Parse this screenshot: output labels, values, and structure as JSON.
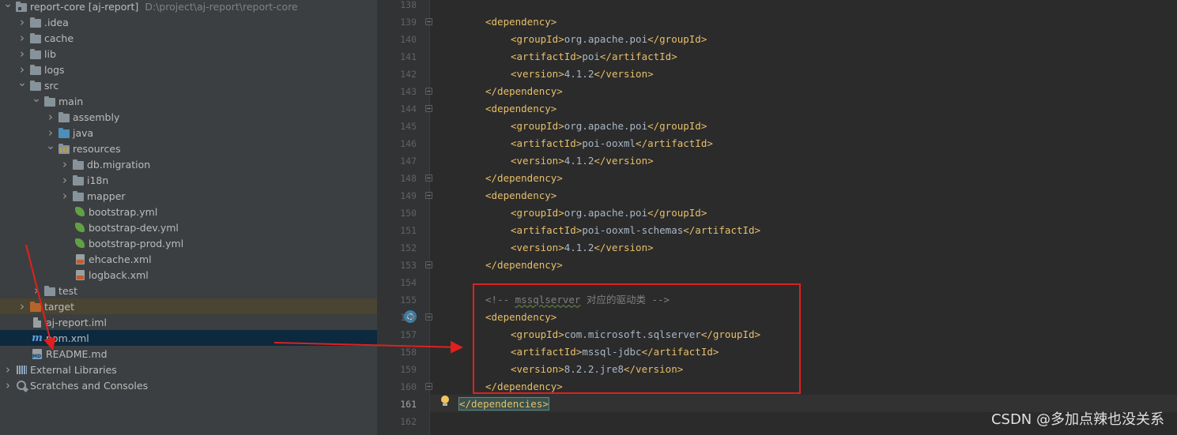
{
  "project_tree": {
    "root": {
      "name": "report-core [aj-report]",
      "path": "D:\\project\\aj-report\\report-core"
    },
    "items": [
      {
        "label": ".idea",
        "icon": "folder-icon"
      },
      {
        "label": "cache",
        "icon": "folder-icon"
      },
      {
        "label": "lib",
        "icon": "folder-icon"
      },
      {
        "label": "logs",
        "icon": "folder-icon"
      },
      {
        "label": "src",
        "icon": "folder-icon"
      },
      {
        "label": "main",
        "icon": "folder-icon"
      },
      {
        "label": "assembly",
        "icon": "folder-icon"
      },
      {
        "label": "java",
        "icon": "source-folder-icon"
      },
      {
        "label": "resources",
        "icon": "resources-folder-icon"
      },
      {
        "label": "db.migration",
        "icon": "folder-icon"
      },
      {
        "label": "i18n",
        "icon": "folder-icon"
      },
      {
        "label": "mapper",
        "icon": "folder-icon"
      },
      {
        "label": "bootstrap.yml",
        "icon": "spring-leaf-icon"
      },
      {
        "label": "bootstrap-dev.yml",
        "icon": "spring-leaf-icon"
      },
      {
        "label": "bootstrap-prod.yml",
        "icon": "spring-leaf-icon"
      },
      {
        "label": "ehcache.xml",
        "icon": "xml-file-icon"
      },
      {
        "label": "logback.xml",
        "icon": "xml-file-icon"
      },
      {
        "label": "test",
        "icon": "folder-icon"
      },
      {
        "label": "target",
        "icon": "excluded-folder-icon"
      },
      {
        "label": "aj-report.iml",
        "icon": "iml-file-icon"
      },
      {
        "label": "pom.xml",
        "icon": "maven-icon"
      },
      {
        "label": "README.md",
        "icon": "markdown-file-icon"
      },
      {
        "label": "External Libraries",
        "icon": "library-icon"
      },
      {
        "label": "Scratches and Consoles",
        "icon": "scratch-icon"
      }
    ],
    "selected": "pom.xml"
  },
  "editor": {
    "line_numbers": [
      "138",
      "139",
      "140",
      "141",
      "142",
      "143",
      "144",
      "145",
      "146",
      "147",
      "148",
      "149",
      "150",
      "151",
      "152",
      "153",
      "154",
      "155",
      "156",
      "157",
      "158",
      "159",
      "160",
      "161",
      "162"
    ],
    "current_line": "161",
    "lines": [
      {
        "parts": []
      },
      {
        "parts": [
          {
            "t": "<dependency>",
            "c": "tag"
          }
        ]
      },
      {
        "parts": [
          {
            "t": "<groupId>",
            "c": "tag"
          },
          {
            "t": "org.apache.poi",
            "c": "txt"
          },
          {
            "t": "</groupId>",
            "c": "tag"
          }
        ]
      },
      {
        "parts": [
          {
            "t": "<artifactId>",
            "c": "tag"
          },
          {
            "t": "poi",
            "c": "txt"
          },
          {
            "t": "</artifactId>",
            "c": "tag"
          }
        ]
      },
      {
        "parts": [
          {
            "t": "<version>",
            "c": "tag"
          },
          {
            "t": "4.1.2",
            "c": "txt"
          },
          {
            "t": "</version>",
            "c": "tag"
          }
        ]
      },
      {
        "parts": [
          {
            "t": "</dependency>",
            "c": "tag"
          }
        ]
      },
      {
        "parts": [
          {
            "t": "<dependency>",
            "c": "tag"
          }
        ]
      },
      {
        "parts": [
          {
            "t": "<groupId>",
            "c": "tag"
          },
          {
            "t": "org.apache.poi",
            "c": "txt"
          },
          {
            "t": "</groupId>",
            "c": "tag"
          }
        ]
      },
      {
        "parts": [
          {
            "t": "<artifactId>",
            "c": "tag"
          },
          {
            "t": "poi-ooxml",
            "c": "txt"
          },
          {
            "t": "</artifactId>",
            "c": "tag"
          }
        ]
      },
      {
        "parts": [
          {
            "t": "<version>",
            "c": "tag"
          },
          {
            "t": "4.1.2",
            "c": "txt"
          },
          {
            "t": "</version>",
            "c": "tag"
          }
        ]
      },
      {
        "parts": [
          {
            "t": "</dependency>",
            "c": "tag"
          }
        ]
      },
      {
        "parts": [
          {
            "t": "<dependency>",
            "c": "tag"
          }
        ]
      },
      {
        "parts": [
          {
            "t": "<groupId>",
            "c": "tag"
          },
          {
            "t": "org.apache.poi",
            "c": "txt"
          },
          {
            "t": "</groupId>",
            "c": "tag"
          }
        ]
      },
      {
        "parts": [
          {
            "t": "<artifactId>",
            "c": "tag"
          },
          {
            "t": "poi-ooxml-schemas",
            "c": "txt"
          },
          {
            "t": "</artifactId>",
            "c": "tag"
          }
        ]
      },
      {
        "parts": [
          {
            "t": "<version>",
            "c": "tag"
          },
          {
            "t": "4.1.2",
            "c": "txt"
          },
          {
            "t": "</version>",
            "c": "tag"
          }
        ]
      },
      {
        "parts": [
          {
            "t": "</dependency>",
            "c": "tag"
          }
        ]
      },
      {
        "parts": []
      },
      {
        "parts": [
          {
            "t": "<!-- ",
            "c": "cmt"
          },
          {
            "t": "mssqlserver",
            "c": "cmt-u"
          },
          {
            "t": " 对应的驱动类 -->",
            "c": "cmt"
          }
        ]
      },
      {
        "parts": [
          {
            "t": "<dependency>",
            "c": "tag"
          }
        ]
      },
      {
        "parts": [
          {
            "t": "<groupId>",
            "c": "tag"
          },
          {
            "t": "com.microsoft.sqlserver",
            "c": "txt"
          },
          {
            "t": "</groupId>",
            "c": "tag"
          }
        ]
      },
      {
        "parts": [
          {
            "t": "<artifactId>",
            "c": "tag"
          },
          {
            "t": "mssql-jdbc",
            "c": "txt"
          },
          {
            "t": "</artifactId>",
            "c": "tag"
          }
        ]
      },
      {
        "parts": [
          {
            "t": "<version>",
            "c": "tag"
          },
          {
            "t": "8.2.2.jre8",
            "c": "txt"
          },
          {
            "t": "</version>",
            "c": "tag"
          }
        ]
      },
      {
        "parts": [
          {
            "t": "</dependency>",
            "c": "tag"
          }
        ]
      },
      {
        "parts": [
          {
            "t": "</dependencies>",
            "c": "tag match"
          }
        ]
      },
      {
        "parts": []
      }
    ]
  },
  "watermark": "CSDN @多加点辣也没关系",
  "colors": {
    "annotation_red": "#e0201e",
    "tag": "#e8bf6a",
    "text": "#a9b7c6",
    "comment": "#808080"
  }
}
